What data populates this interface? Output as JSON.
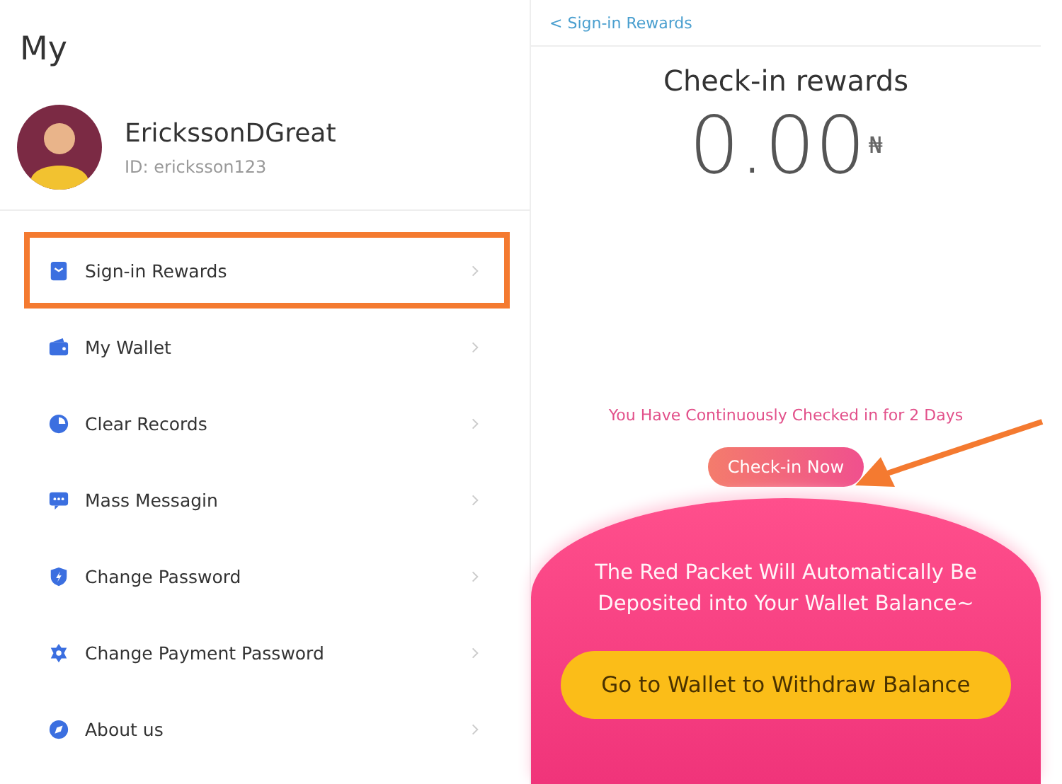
{
  "profile_screen": {
    "title": "My",
    "user": {
      "name": "ErickssonDGreat",
      "id": "ID: ericksson123"
    },
    "menu": [
      {
        "label": "Sign-in Rewards",
        "highlighted": true
      },
      {
        "label": "My Wallet",
        "highlighted": false
      },
      {
        "label": "Clear Records",
        "highlighted": false
      },
      {
        "label": "Mass Messagin",
        "highlighted": false
      },
      {
        "label": "Change Password",
        "highlighted": false
      },
      {
        "label": "Change Payment Password",
        "highlighted": false
      },
      {
        "label": "About us",
        "highlighted": false
      }
    ]
  },
  "rewards_screen": {
    "back_link": "< Sign-in Rewards",
    "title": "Check-in rewards",
    "amount": "0.00",
    "currency": "₦",
    "streak": "You Have Continuously Checked in for 2 Days",
    "check_in_button": "Check-in Now",
    "annotation_arrow": true,
    "message": "The Red Packet Will Automatically Be Deposited into Your Wallet Balance~",
    "wallet_button": "Go to Wallet to Withdraw Balance"
  }
}
